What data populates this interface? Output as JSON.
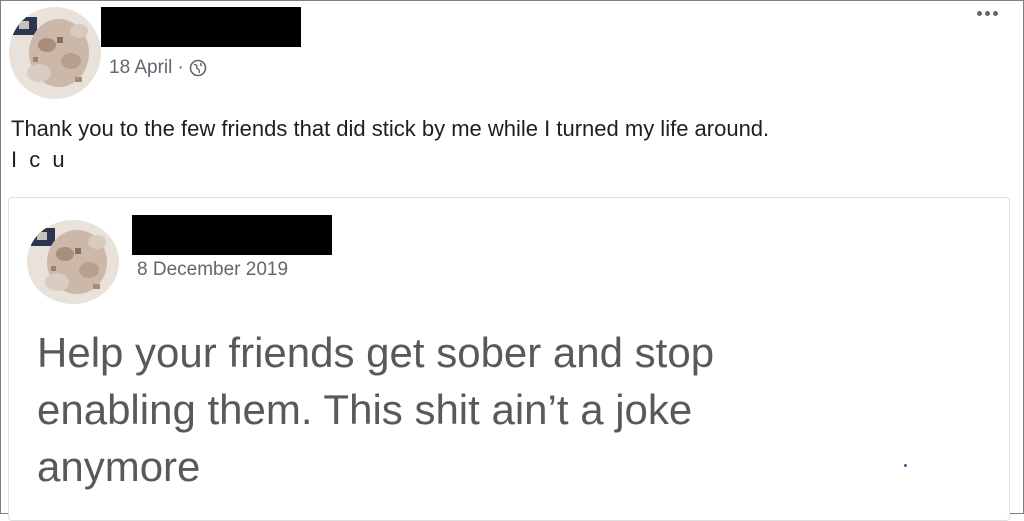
{
  "post": {
    "date": "18 April",
    "separator": "·",
    "privacy_icon": "globe-icon",
    "text_lines": [
      "Thank you to the few friends that did stick by me while I turned my life around.",
      "I c u"
    ],
    "more_icon": "more-options-icon"
  },
  "shared_post": {
    "date": "8 December 2019",
    "text_lines": [
      "Help your friends get sober and stop",
      "enabling them. This shit ain’t a joke",
      "anymore"
    ]
  },
  "colors": {
    "meta_text": "#616770",
    "body_text": "#1c1e21",
    "shared_text": "#595959",
    "redaction": "#000000"
  }
}
